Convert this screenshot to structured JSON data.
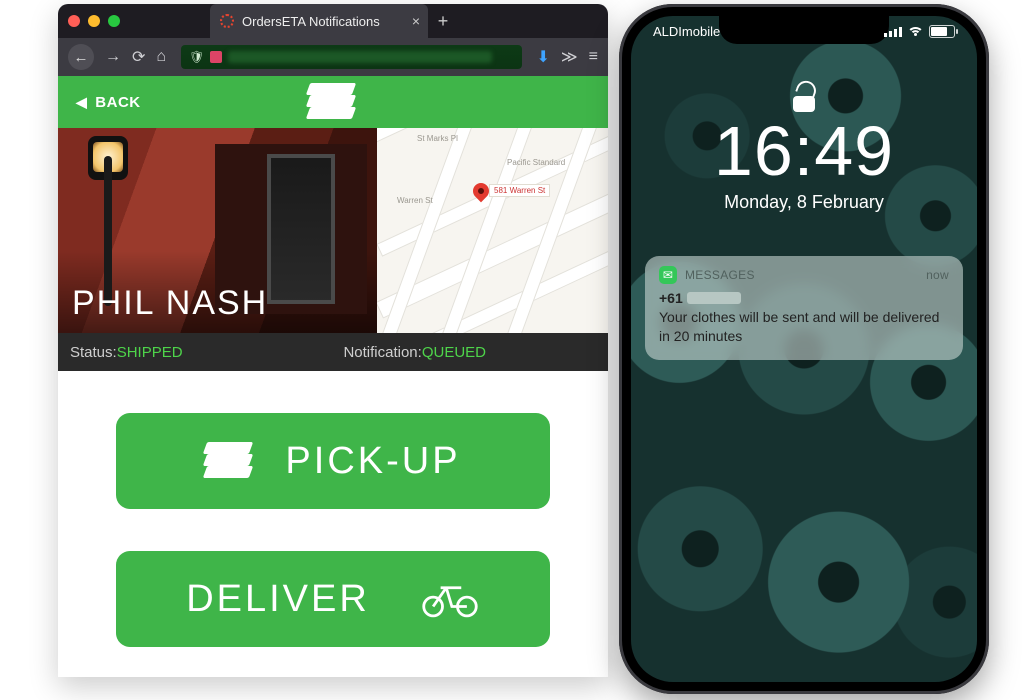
{
  "browser": {
    "tab_title": "OrdersETA Notifications"
  },
  "app": {
    "back_label": "BACK",
    "customer_name": "PHIL NASH",
    "map_pin_label": "581 Warren St",
    "status_label": "Status:",
    "status_value": "SHIPPED",
    "notif_label": "Notification:",
    "notif_value": "QUEUED",
    "pickup_label": "PICK-UP",
    "deliver_label": "DELIVER"
  },
  "phone": {
    "carrier": "ALDImobile",
    "time": "16:49",
    "date": "Monday, 8 February",
    "notification": {
      "app_name": "MESSAGES",
      "timestamp": "now",
      "sender": "+61",
      "body": "Your clothes will be sent and will be delivered in 20 minutes"
    }
  }
}
